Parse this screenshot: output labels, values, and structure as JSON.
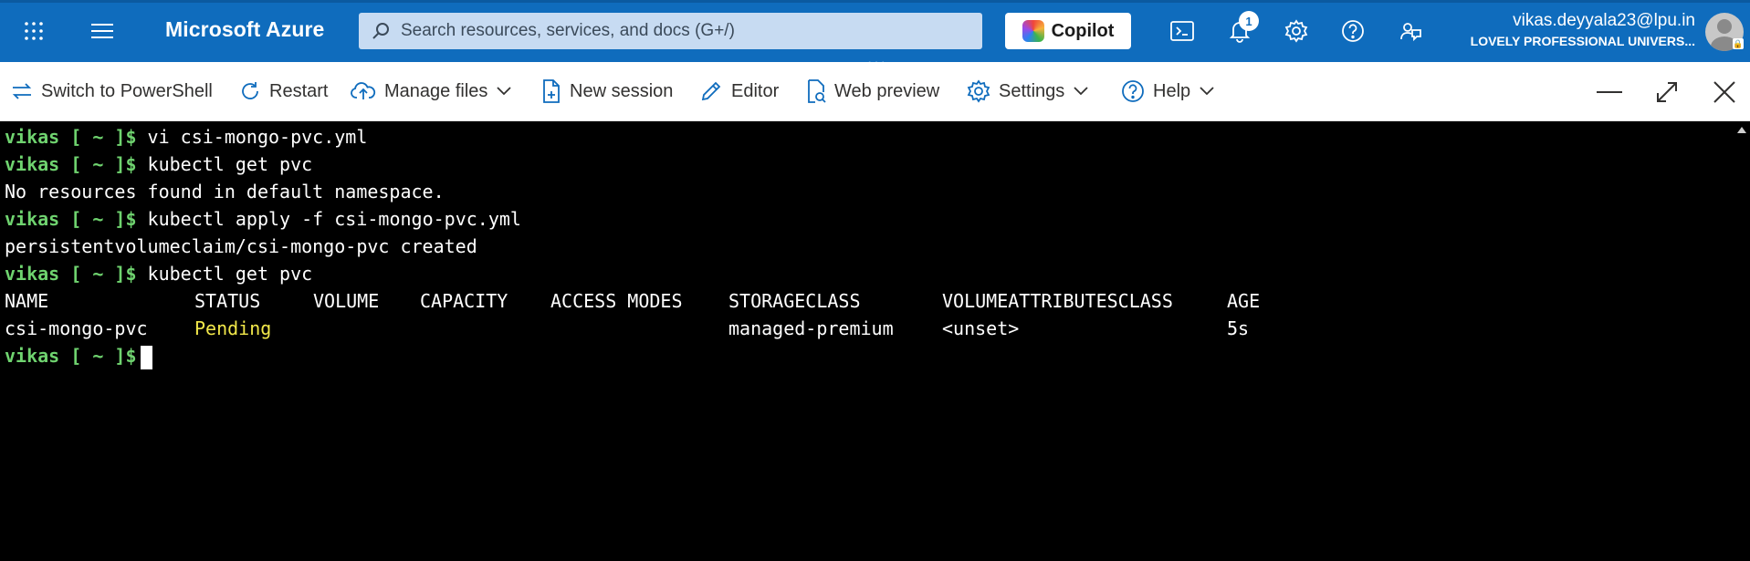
{
  "header": {
    "brand": "Microsoft Azure",
    "search_placeholder": "Search resources, services, and docs (G+/)",
    "copilot_label": "Copilot",
    "notifications_count": "1",
    "user_email": "vikas.deyyala23@lpu.in",
    "user_org": "LOVELY PROFESSIONAL UNIVERS..."
  },
  "toolbar": {
    "switch_label": "Switch to PowerShell",
    "restart_label": "Restart",
    "manage_files_label": "Manage files",
    "new_session_label": "New session",
    "editor_label": "Editor",
    "web_preview_label": "Web preview",
    "settings_label": "Settings",
    "help_label": "Help"
  },
  "terminal": {
    "prompt": "vikas [ ~ ]$",
    "lines": [
      {
        "type": "cmd",
        "text": "vi csi-mongo-pvc.yml"
      },
      {
        "type": "cmd",
        "text": "kubectl get pvc"
      },
      {
        "type": "out",
        "text": "No resources found in default namespace."
      },
      {
        "type": "cmd",
        "text": "kubectl apply -f csi-mongo-pvc.yml"
      },
      {
        "type": "out",
        "text": "persistentvolumeclaim/csi-mongo-pvc created"
      },
      {
        "type": "cmd",
        "text": "kubectl get pvc"
      }
    ],
    "table": {
      "headers": [
        "NAME",
        "STATUS",
        "VOLUME",
        "CAPACITY",
        "ACCESS MODES",
        "STORAGECLASS",
        "VOLUMEATTRIBUTESCLASS",
        "AGE"
      ],
      "row": [
        "csi-mongo-pvc",
        "Pending",
        "",
        "",
        "",
        "managed-premium",
        "<unset>",
        "5s"
      ]
    },
    "status_color": "#f2e84a",
    "prompt_color": "#6fd36f"
  }
}
